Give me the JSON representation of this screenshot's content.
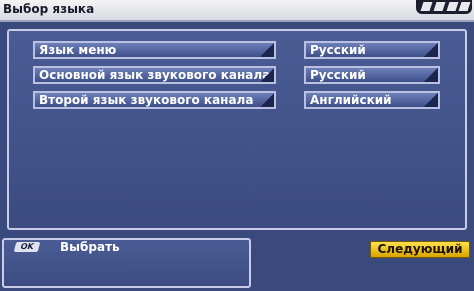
{
  "window": {
    "title": "Выбор языка"
  },
  "settings": {
    "labels": [
      "Язык меню",
      "Основной язык звукового канала",
      "Второй язык звукового канала"
    ],
    "values": [
      "Русский",
      "Русский",
      "Английский"
    ]
  },
  "footer": {
    "ok_key": "OK",
    "ok_label": "Выбрать",
    "next_label": "Следующий"
  },
  "colors": {
    "background": "#3a4a7c",
    "field": "#4e5f98",
    "accent_button": "#f0c21a"
  }
}
